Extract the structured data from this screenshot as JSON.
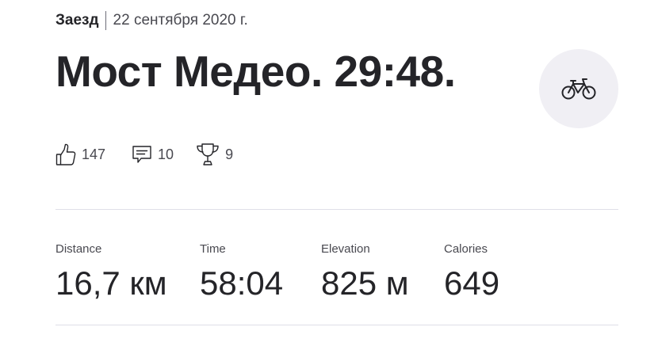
{
  "activity": {
    "type_label": "Заезд",
    "date": "22 сентября 2020 г.",
    "title": "Мост Медео. 29:48.",
    "sport_icon": "bike-icon"
  },
  "social": {
    "kudos_count": "147",
    "comments_count": "10",
    "achievements_count": "9"
  },
  "stats": [
    {
      "label": "Distance",
      "value": "16,7 км"
    },
    {
      "label": "Time",
      "value": "58:04"
    },
    {
      "label": "Elevation",
      "value": "825 м"
    },
    {
      "label": "Calories",
      "value": "649"
    }
  ],
  "colors": {
    "text_primary": "#242428",
    "text_secondary": "#494950",
    "badge_bg": "#f0eff4",
    "divider": "#dfdfe8"
  }
}
